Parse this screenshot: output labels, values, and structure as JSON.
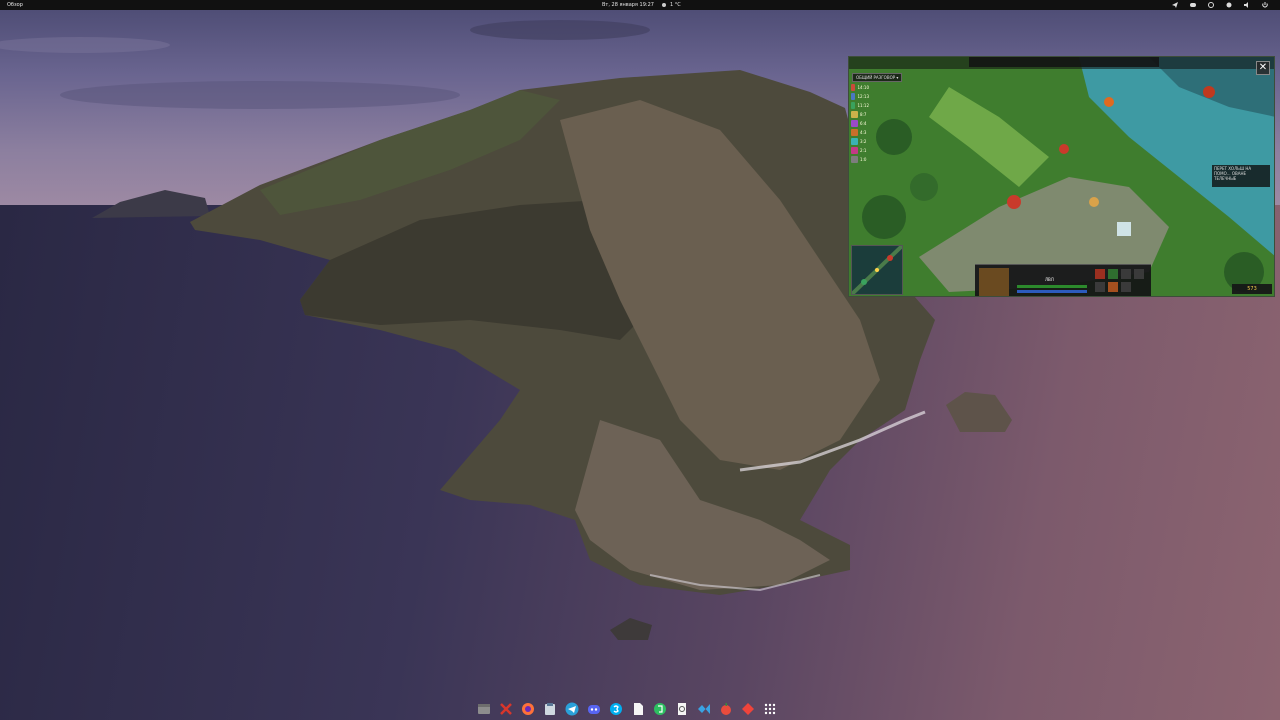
{
  "topbar": {
    "activities_label": "Обзор",
    "clock": "Вт, 28 января 19:27",
    "weather": "1 °C",
    "tray_icons": [
      "telegram-icon",
      "discord-icon",
      "network-icon",
      "skype-icon",
      "volume-icon",
      "power-icon"
    ]
  },
  "pip": {
    "close_label": "✕",
    "game_tag": "ОБЩИЙ РАЗГОВОР ▾",
    "hero_stats": [
      "14:10",
      "12:13",
      "11:12",
      "8:7",
      "6:4",
      "4:3",
      "3:2",
      "2:1",
      "1:0"
    ],
    "hero_colors": [
      "#c94b3a",
      "#4a78c2",
      "#3aa25d",
      "#cbb24a",
      "#9a4ac9",
      "#c96f2a",
      "#3ab2b2",
      "#c23a86",
      "#7d7d7d"
    ],
    "killfeed_text": "ПЕРЕТ ХОЛЬШ НА ПОМО... ОВАНЕ ТЕЛЕЧНЫЕ",
    "hud_level": "ЛВЛ",
    "gold": "573"
  },
  "dock": {
    "items": [
      {
        "name": "files-icon",
        "color": "#8d8d8d"
      },
      {
        "name": "codeweavers-icon",
        "color": "#d8362b"
      },
      {
        "name": "firefox-icon",
        "color": "#ff7139"
      },
      {
        "name": "clipboard-icon",
        "color": "#cfd8e0"
      },
      {
        "name": "telegram-icon",
        "color": "#2aa1da"
      },
      {
        "name": "discord-icon",
        "color": "#5865f2"
      },
      {
        "name": "skype-icon",
        "color": "#00aff0"
      },
      {
        "name": "document-icon",
        "color": "#f5f5f5"
      },
      {
        "name": "evernote-icon",
        "color": "#2dbe60"
      },
      {
        "name": "clock-icon",
        "color": "#f5f5f5"
      },
      {
        "name": "vscode-icon",
        "color": "#3aa3e3"
      },
      {
        "name": "apple-icon",
        "color": "#e94c3d"
      },
      {
        "name": "anydesk-icon",
        "color": "#ef443b"
      },
      {
        "name": "app-grid-icon",
        "color": "#ffffff"
      }
    ]
  }
}
